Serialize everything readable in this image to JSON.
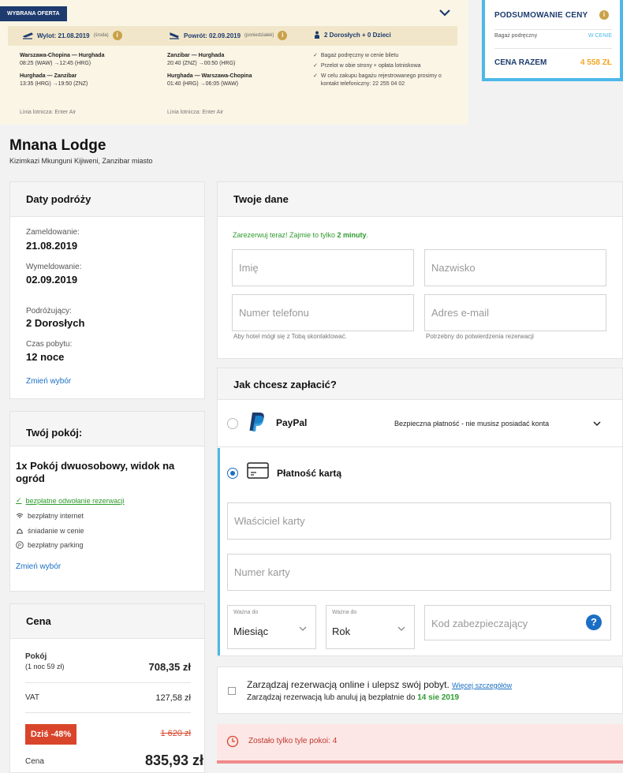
{
  "offer": {
    "tag": "WYBRANA OFERTA",
    "outbound_label": "Wylot: 21.08.2019",
    "outbound_day": "(środa)",
    "return_label": "Powrót: 02.09.2019",
    "return_day": "(poniedziałek)",
    "passengers": "2 Dorosłych + 0 Dzieci",
    "outbound_segments": [
      {
        "route": "Warszawa-Chopina — Hurghada",
        "times": "08:25 (WAW) →12:45 (HRG)"
      },
      {
        "route": "Hurghada — Zanzibar",
        "times": "13:35 (HRG) →19:50 (ZNZ)"
      }
    ],
    "return_segments": [
      {
        "route": "Zanzibar — Hurghada",
        "times": "20:40 (ZNZ) →00:50 (HRG)"
      },
      {
        "route": "Hurghada — Warszawa-Chopina",
        "times": "01:40 (HRG) →06:05 (WAW)"
      }
    ],
    "airline_out": "Linia lotnicza: Enter Air",
    "airline_ret": "Linia lotnicza: Enter Air",
    "included": [
      "Bagaż podręczny w cenie biletu",
      "Przelot w obie strony + opłata lotniskowa",
      "W celu zakupu bagażu rejestrowanego prosimy o kontakt telefoniczny: 22 255 04 02"
    ]
  },
  "summary": {
    "title": "PODSUMOWANIE CENY",
    "row_label": "Bagaż podręczny",
    "row_value": "W CENIE",
    "total_label": "CENA RAZEM",
    "total_value": "4 558 ZŁ"
  },
  "hotel": {
    "name": "Mnana Lodge",
    "address": "Kizimkazi Mkunguni Kijiweni, Zanzibar miasto"
  },
  "dates_card": {
    "title": "Daty podróży",
    "checkin_label": "Zameldowanie:",
    "checkin_value": "21.08.2019",
    "checkout_label": "Wymeldowanie:",
    "checkout_value": "02.09.2019",
    "travelers_label": "Podróżujący:",
    "travelers_value": "2 Dorosłych",
    "stay_label": "Czas pobytu:",
    "stay_value": "12 noce",
    "change": "Zmień wybór"
  },
  "room_card": {
    "title": "Twój pokój:",
    "room": "1x Pokój dwuosobowy, widok na ogród",
    "amenities": [
      "bezpłatne odwołanie rezerwacji",
      "bezpłatny internet",
      "śniadanie w cenie",
      "bezpłatny parking"
    ],
    "change": "Zmień wybór"
  },
  "price_card": {
    "title": "Cena",
    "room_label": "Pokój",
    "room_sub": "(1 noc 59 zł)",
    "room_value": "708,35 zł",
    "vat_label": "VAT",
    "vat_value": "127,58 zł",
    "discount_badge": "Dziś -48%",
    "old_price": "1 620 zł",
    "price_label": "Cena",
    "price_value": "835,93 zł"
  },
  "your_data": {
    "title": "Twoje dane",
    "promo": "Zarezerwuj teraz! Zajmie to tylko ",
    "promo_bold": "2 minuty",
    "promo_end": ".",
    "first_name": "Imię",
    "last_name": "Nazwisko",
    "phone": "Numer telefonu",
    "email": "Adres e-mail",
    "phone_hint": "Aby hotel mógł się z Tobą skontaktować.",
    "email_hint": "Potrzebny do potwierdzenia rezerwacji"
  },
  "payment": {
    "title": "Jak chcesz zapłacić?",
    "paypal": "PayPal",
    "paypal_note": "Bezpieczna płatność - nie musisz posiadać konta",
    "card": "Płatność kartą",
    "holder": "Właściciel karty",
    "number": "Numer karty",
    "valid_label_1": "Ważna do",
    "month": "Miesiąc",
    "valid_label_2": "Ważna do",
    "year": "Rok",
    "cvc": "Kod zabezpieczający",
    "cvc_help": "?"
  },
  "manage": {
    "text": "Zarządzaj rezerwacją online i ulepsz swój pobyt.",
    "more": "Więcej szczegółów",
    "sub": "Zarządzaj rezerwacją lub anuluj ją bezpłatnie do ",
    "sub_date": "14 sie 2019"
  },
  "alert": {
    "text": "Zostało tylko tyle pokoi: 4"
  },
  "colors": {
    "navy": "#1d3b6e",
    "accent_blue": "#4db8e8",
    "orange": "#f5a623",
    "green": "#2e9b2e",
    "link": "#1a6fc4",
    "discount": "#d9452b"
  }
}
